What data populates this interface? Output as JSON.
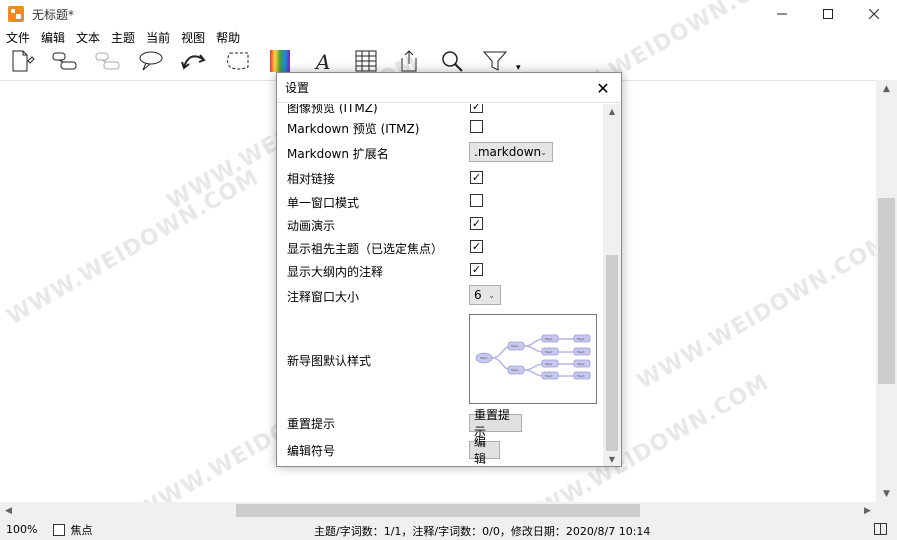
{
  "window": {
    "title": "无标题*",
    "controls": [
      "minimize",
      "maximize",
      "close"
    ]
  },
  "menubar": {
    "items": [
      "文件",
      "编辑",
      "文本",
      "主题",
      "当前",
      "视图",
      "帮助"
    ]
  },
  "toolbar": {
    "icons": [
      "new-document-icon",
      "add-topic-icon",
      "add-subtopic-icon",
      "callout-icon",
      "relationship-icon",
      "boundary-icon",
      "color-icon",
      "font-icon",
      "table-icon",
      "export-icon",
      "search-icon",
      "filter-icon"
    ]
  },
  "dialog": {
    "title": "设置",
    "close_glyph": "✕",
    "rows": {
      "image_preview": "图像预览 (ITMZ)",
      "markdown_preview": "Markdown 预览 (ITMZ)",
      "markdown_ext": "Markdown 扩展名",
      "relative_links": "相对链接",
      "single_window": "单一窗口模式",
      "animation": "动画演示",
      "show_ancestors": "显示祖先主题（已选定焦点）",
      "show_notes_outline": "显示大纲内的注释",
      "note_window_size": "注释窗口大小",
      "default_style": "新导图默认样式",
      "reset_hints": "重置提示",
      "edit_symbols": "编辑符号"
    },
    "checks": {
      "image_preview": true,
      "markdown_preview": false,
      "relative_links": true,
      "single_window": false,
      "animation": true,
      "show_ancestors": true,
      "show_notes_outline": true
    },
    "markdown_ext_value": ".markdown",
    "note_window_size_value": "6",
    "reset_hints_button": "重置提示",
    "edit_button": "编辑",
    "preview_labels": {
      "root": "Topic",
      "branch": "Topic",
      "leaf": "Topic"
    }
  },
  "watermark": {
    "text": "WWW.WEIDOWN.COM"
  },
  "status": {
    "zoom": "100%",
    "focus_label": "焦点",
    "focus_checked": false,
    "info": "主题/字词数：1/1，注释/字词数：0/0，修改日期：2020/8/7 10:14"
  }
}
